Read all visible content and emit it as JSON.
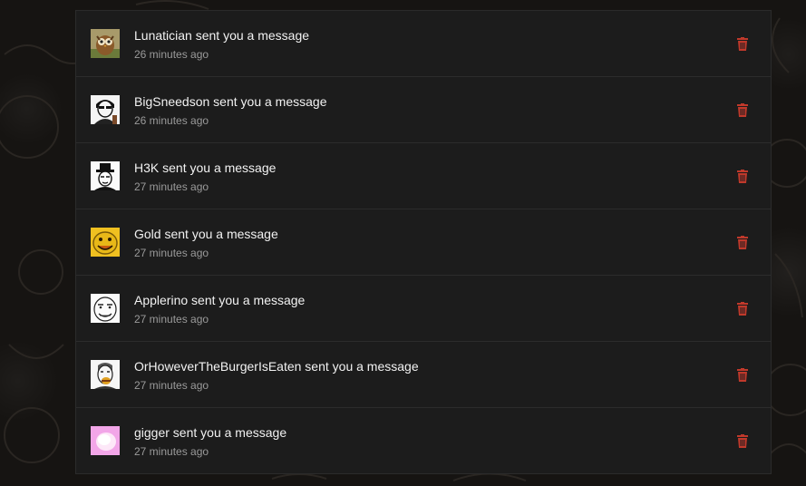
{
  "notifications": [
    {
      "user": "Lunatician",
      "text": "Lunatician sent you a message",
      "time": "26 minutes ago",
      "avatar_icon": "owl-avatar-icon"
    },
    {
      "user": "BigSneedson",
      "text": "BigSneedson sent you a message",
      "time": "26 minutes ago",
      "avatar_icon": "bw-portrait-avatar-icon"
    },
    {
      "user": "H3K",
      "text": "H3K sent you a message",
      "time": "27 minutes ago",
      "avatar_icon": "hat-man-avatar-icon"
    },
    {
      "user": "Gold",
      "text": "Gold sent you a message",
      "time": "27 minutes ago",
      "avatar_icon": "yellow-face-avatar-icon"
    },
    {
      "user": "Applerino",
      "text": "Applerino sent you a message",
      "time": "27 minutes ago",
      "avatar_icon": "sketch-face-avatar-icon"
    },
    {
      "user": "OrHoweverTheBurgerIsEaten",
      "text": "OrHoweverTheBurgerIsEaten sent you a message",
      "time": "27 minutes ago",
      "avatar_icon": "burger-face-avatar-icon"
    },
    {
      "user": "gigger",
      "text": "gigger sent you a message",
      "time": "27 minutes ago",
      "avatar_icon": "pink-blob-avatar-icon"
    }
  ],
  "colors": {
    "panel": "#1c1c1c",
    "divider": "#2c2c2c",
    "text": "#f2f2f2",
    "muted": "#9a9a9a",
    "delete": "#c0392b"
  },
  "delete_icon": "trash-icon"
}
